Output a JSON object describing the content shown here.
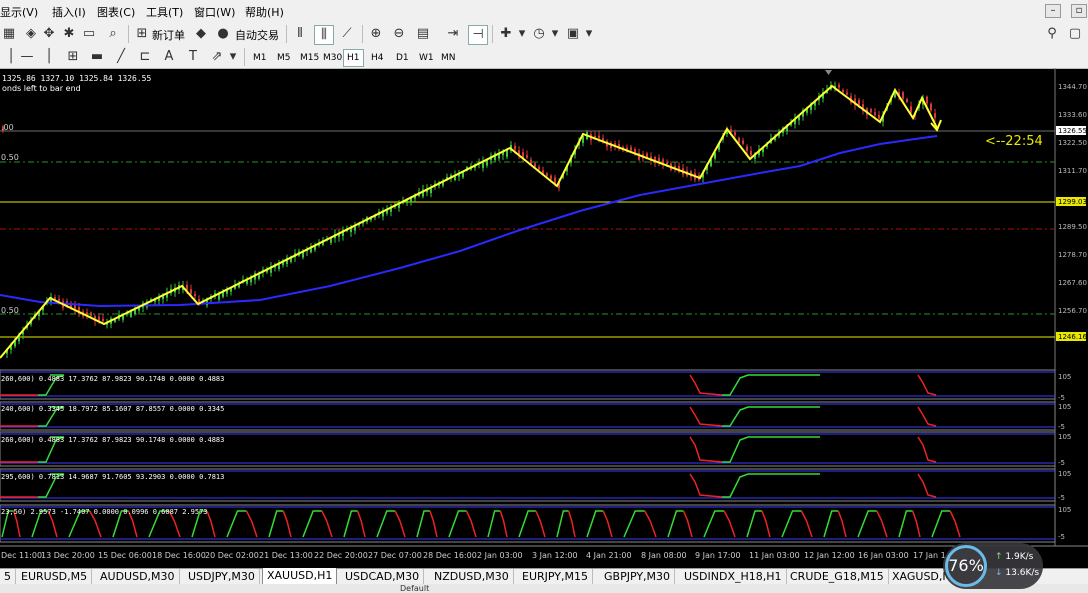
{
  "menu": [
    "显示(V)",
    "插入(I)",
    "图表(C)",
    "工具(T)",
    "窗口(W)",
    "帮助(H)"
  ],
  "window_controls": [
    "–",
    "▫",
    "✕"
  ],
  "toolbar": {
    "new_order": "新订单",
    "auto_trading": "自动交易",
    "timeframes": [
      "M1",
      "M5",
      "M15",
      "M30",
      "H1",
      "H4",
      "D1",
      "W1",
      "MN"
    ],
    "active_timeframe": "H1"
  },
  "chart": {
    "ohlc_text": "1325.86 1327.10 1325.84 1326.55",
    "bar_end_text": "onds left to bar end",
    "left_labels": [
      ".00",
      "0.50",
      "0.50"
    ],
    "countdown": "<--22:54",
    "price_labels": [
      "1344.70",
      "1333.60",
      "1322.50",
      "1311.70",
      "1289.50",
      "1278.70",
      "1267.60",
      "1256.70"
    ],
    "price_line_labels": {
      "current": "1326.55",
      "yellow_top": "1299.03",
      "yellow_bottom": "1246.16"
    },
    "date_labels": [
      "Dec 11:00",
      "13 Dec 20:00",
      "15 Dec 06:00",
      "18 Dec 16:00",
      "20 Dec 02:00",
      "21 Dec 13:00",
      "22 Dec 20:00",
      "27 Dec 07:00",
      "28 Dec 16:00",
      "2 Jan 03:00",
      "3 Jan 12:00",
      "4 Jan 21:00",
      "8 Jan 08:00",
      "9 Jan 17:00",
      "11 Jan 03:00",
      "12 Jan 12:00",
      "16 Jan 03:00",
      "17 Jan 1"
    ],
    "indicator_panels": [
      {
        "text": "260,600) 0.4883 17.3762 87.9823 90.1748 0.0000 0.4883",
        "top": "105",
        "bottom": "-5"
      },
      {
        "text": "240,600) 0.3345 18.7972 85.1607 87.8557 0.0000 0.3345",
        "top": "105",
        "bottom": "-5"
      },
      {
        "text": "260,600) 0.4883 17.3762 87.9823 90.1748 0.0000 0.4883",
        "top": "105",
        "bottom": "-5"
      },
      {
        "text": "295,600) 0.7813 14.9687 91.7605 93.2903 0.0000 0.7813",
        "top": "105",
        "bottom": "-5"
      },
      {
        "text": "23,50) 2.9573 -1.7407 0.0000 0.0996 0.6087 2.9573",
        "top": "105",
        "bottom": "-5"
      }
    ]
  },
  "symbol_tabs": [
    "5",
    "EURUSD,M5",
    "AUDUSD,M30",
    "USDJPY,M30",
    "XAUUSD,H1",
    "USDCAD,M30",
    "NZDUSD,M30",
    "EURJPY,M15",
    "GBPJPY,M30",
    "USDINDX_H18,H1",
    "CRUDE_G18,M15",
    "XAGUSD,M"
  ],
  "active_symbol_tab": "XAUUSD,H1",
  "status": {
    "text": "Default"
  },
  "speed_widget": {
    "percent": "76%",
    "up": "1.9K/s",
    "down": "13.6K/s"
  },
  "colors": {
    "zigzag": "#ffff33",
    "moving_average": "#2a2aff",
    "bull_candle": "#3cc83c",
    "bear_candle": "#d83a3a",
    "indicator_up": "#33dd33",
    "indicator_down": "#ee2222",
    "level_yellow": "#e8e800",
    "level_red": "#aa1111",
    "level_green_dash": "#2a8f2a",
    "grid_gray": "#6e6e6e"
  }
}
